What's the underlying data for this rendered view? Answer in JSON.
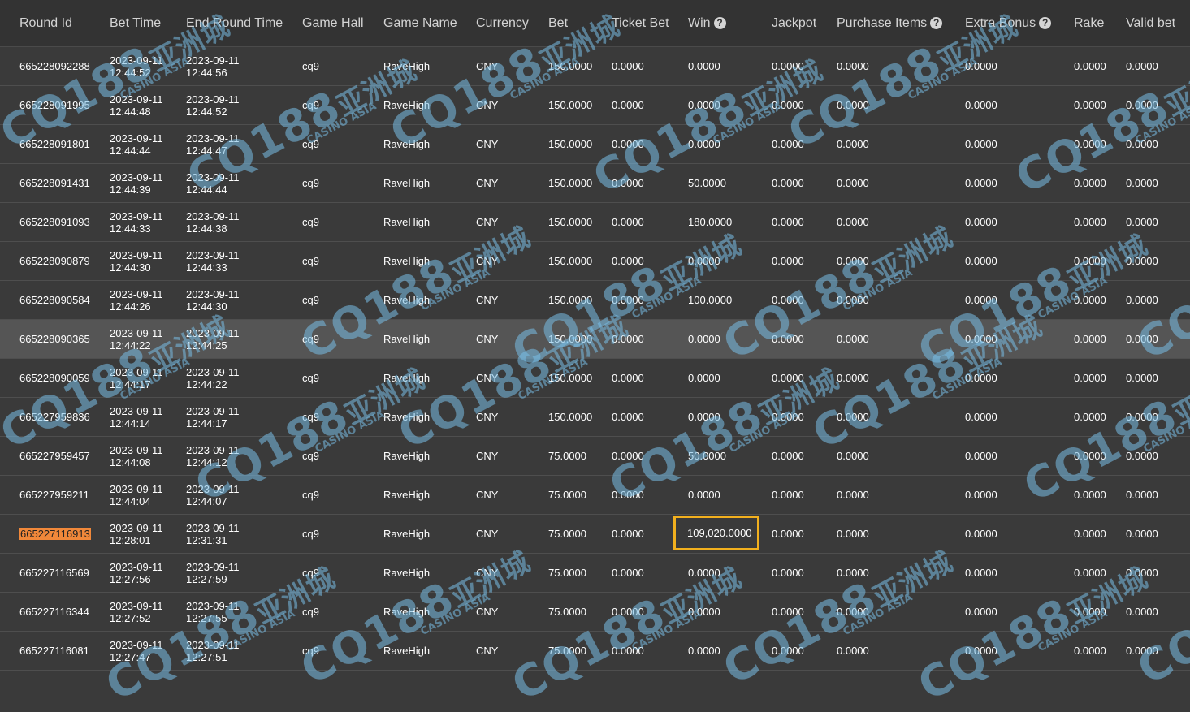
{
  "headers": [
    {
      "label": "Round Id",
      "help": false
    },
    {
      "label": "Bet Time",
      "help": false
    },
    {
      "label": "End Round Time",
      "help": false
    },
    {
      "label": "Game Hall",
      "help": false
    },
    {
      "label": "Game Name",
      "help": false
    },
    {
      "label": "Currency",
      "help": false
    },
    {
      "label": "Bet",
      "help": false
    },
    {
      "label": "Ticket Bet",
      "help": false
    },
    {
      "label": "Win",
      "help": true
    },
    {
      "label": "Jackpot",
      "help": false
    },
    {
      "label": "Purchase Items",
      "help": true
    },
    {
      "label": "Extra Bonus",
      "help": true
    },
    {
      "label": "Rake",
      "help": false
    },
    {
      "label": "Valid bet",
      "help": false
    }
  ],
  "help_glyph": "?",
  "rows": [
    {
      "round_id": "665228092288",
      "bet_date": "2023-09-11",
      "bet_time": "12:44:52",
      "end_date": "2023-09-11",
      "end_time": "12:44:56",
      "hall": "cq9",
      "game": "RaveHigh",
      "currency": "CNY",
      "bet": "150.0000",
      "ticket_bet": "0.0000",
      "win": "0.0000",
      "jackpot": "0.0000",
      "purchase": "0.0000",
      "extra": "0.0000",
      "rake": "0.0000",
      "valid": "0.0000"
    },
    {
      "round_id": "665228091995",
      "bet_date": "2023-09-11",
      "bet_time": "12:44:48",
      "end_date": "2023-09-11",
      "end_time": "12:44:52",
      "hall": "cq9",
      "game": "RaveHigh",
      "currency": "CNY",
      "bet": "150.0000",
      "ticket_bet": "0.0000",
      "win": "0.0000",
      "jackpot": "0.0000",
      "purchase": "0.0000",
      "extra": "0.0000",
      "rake": "0.0000",
      "valid": "0.0000"
    },
    {
      "round_id": "665228091801",
      "bet_date": "2023-09-11",
      "bet_time": "12:44:44",
      "end_date": "2023-09-11",
      "end_time": "12:44:47",
      "hall": "cq9",
      "game": "RaveHigh",
      "currency": "CNY",
      "bet": "150.0000",
      "ticket_bet": "0.0000",
      "win": "0.0000",
      "jackpot": "0.0000",
      "purchase": "0.0000",
      "extra": "0.0000",
      "rake": "0.0000",
      "valid": "0.0000"
    },
    {
      "round_id": "665228091431",
      "bet_date": "2023-09-11",
      "bet_time": "12:44:39",
      "end_date": "2023-09-11",
      "end_time": "12:44:44",
      "hall": "cq9",
      "game": "RaveHigh",
      "currency": "CNY",
      "bet": "150.0000",
      "ticket_bet": "0.0000",
      "win": "50.0000",
      "jackpot": "0.0000",
      "purchase": "0.0000",
      "extra": "0.0000",
      "rake": "0.0000",
      "valid": "0.0000"
    },
    {
      "round_id": "665228091093",
      "bet_date": "2023-09-11",
      "bet_time": "12:44:33",
      "end_date": "2023-09-11",
      "end_time": "12:44:38",
      "hall": "cq9",
      "game": "RaveHigh",
      "currency": "CNY",
      "bet": "150.0000",
      "ticket_bet": "0.0000",
      "win": "180.0000",
      "jackpot": "0.0000",
      "purchase": "0.0000",
      "extra": "0.0000",
      "rake": "0.0000",
      "valid": "0.0000"
    },
    {
      "round_id": "665228090879",
      "bet_date": "2023-09-11",
      "bet_time": "12:44:30",
      "end_date": "2023-09-11",
      "end_time": "12:44:33",
      "hall": "cq9",
      "game": "RaveHigh",
      "currency": "CNY",
      "bet": "150.0000",
      "ticket_bet": "0.0000",
      "win": "0.0000",
      "jackpot": "0.0000",
      "purchase": "0.0000",
      "extra": "0.0000",
      "rake": "0.0000",
      "valid": "0.0000"
    },
    {
      "round_id": "665228090584",
      "bet_date": "2023-09-11",
      "bet_time": "12:44:26",
      "end_date": "2023-09-11",
      "end_time": "12:44:30",
      "hall": "cq9",
      "game": "RaveHigh",
      "currency": "CNY",
      "bet": "150.0000",
      "ticket_bet": "0.0000",
      "win": "100.0000",
      "jackpot": "0.0000",
      "purchase": "0.0000",
      "extra": "0.0000",
      "rake": "0.0000",
      "valid": "0.0000"
    },
    {
      "round_id": "665228090365",
      "bet_date": "2023-09-11",
      "bet_time": "12:44:22",
      "end_date": "2023-09-11",
      "end_time": "12:44:25",
      "hall": "cq9",
      "game": "RaveHigh",
      "currency": "CNY",
      "bet": "150.0000",
      "ticket_bet": "0.0000",
      "win": "0.0000",
      "jackpot": "0.0000",
      "purchase": "0.0000",
      "extra": "0.0000",
      "rake": "0.0000",
      "valid": "0.0000",
      "hovered": true
    },
    {
      "round_id": "665228090059",
      "bet_date": "2023-09-11",
      "bet_time": "12:44:17",
      "end_date": "2023-09-11",
      "end_time": "12:44:22",
      "hall": "cq9",
      "game": "RaveHigh",
      "currency": "CNY",
      "bet": "150.0000",
      "ticket_bet": "0.0000",
      "win": "0.0000",
      "jackpot": "0.0000",
      "purchase": "0.0000",
      "extra": "0.0000",
      "rake": "0.0000",
      "valid": "0.0000"
    },
    {
      "round_id": "665227959836",
      "bet_date": "2023-09-11",
      "bet_time": "12:44:14",
      "end_date": "2023-09-11",
      "end_time": "12:44:17",
      "hall": "cq9",
      "game": "RaveHigh",
      "currency": "CNY",
      "bet": "150.0000",
      "ticket_bet": "0.0000",
      "win": "0.0000",
      "jackpot": "0.0000",
      "purchase": "0.0000",
      "extra": "0.0000",
      "rake": "0.0000",
      "valid": "0.0000"
    },
    {
      "round_id": "665227959457",
      "bet_date": "2023-09-11",
      "bet_time": "12:44:08",
      "end_date": "2023-09-11",
      "end_time": "12:44:12",
      "hall": "cq9",
      "game": "RaveHigh",
      "currency": "CNY",
      "bet": "75.0000",
      "ticket_bet": "0.0000",
      "win": "50.0000",
      "jackpot": "0.0000",
      "purchase": "0.0000",
      "extra": "0.0000",
      "rake": "0.0000",
      "valid": "0.0000"
    },
    {
      "round_id": "665227959211",
      "bet_date": "2023-09-11",
      "bet_time": "12:44:04",
      "end_date": "2023-09-11",
      "end_time": "12:44:07",
      "hall": "cq9",
      "game": "RaveHigh",
      "currency": "CNY",
      "bet": "75.0000",
      "ticket_bet": "0.0000",
      "win": "0.0000",
      "jackpot": "0.0000",
      "purchase": "0.0000",
      "extra": "0.0000",
      "rake": "0.0000",
      "valid": "0.0000"
    },
    {
      "round_id": "665227116913",
      "bet_date": "2023-09-11",
      "bet_time": "12:28:01",
      "end_date": "2023-09-11",
      "end_time": "12:31:31",
      "hall": "cq9",
      "game": "RaveHigh",
      "currency": "CNY",
      "bet": "75.0000",
      "ticket_bet": "0.0000",
      "win": "109,020.0000",
      "jackpot": "0.0000",
      "purchase": "0.0000",
      "extra": "0.0000",
      "rake": "0.0000",
      "valid": "0.0000",
      "round_highlight": true,
      "win_boxed": true
    },
    {
      "round_id": "665227116569",
      "bet_date": "2023-09-11",
      "bet_time": "12:27:56",
      "end_date": "2023-09-11",
      "end_time": "12:27:59",
      "hall": "cq9",
      "game": "RaveHigh",
      "currency": "CNY",
      "bet": "75.0000",
      "ticket_bet": "0.0000",
      "win": "0.0000",
      "jackpot": "0.0000",
      "purchase": "0.0000",
      "extra": "0.0000",
      "rake": "0.0000",
      "valid": "0.0000"
    },
    {
      "round_id": "665227116344",
      "bet_date": "2023-09-11",
      "bet_time": "12:27:52",
      "end_date": "2023-09-11",
      "end_time": "12:27:55",
      "hall": "cq9",
      "game": "RaveHigh",
      "currency": "CNY",
      "bet": "75.0000",
      "ticket_bet": "0.0000",
      "win": "0.0000",
      "jackpot": "0.0000",
      "purchase": "0.0000",
      "extra": "0.0000",
      "rake": "0.0000",
      "valid": "0.0000"
    },
    {
      "round_id": "665227116081",
      "bet_date": "2023-09-11",
      "bet_time": "12:27:47",
      "end_date": "2023-09-11",
      "end_time": "12:27:51",
      "hall": "cq9",
      "game": "RaveHigh",
      "currency": "CNY",
      "bet": "75.0000",
      "ticket_bet": "0.0000",
      "win": "0.0000",
      "jackpot": "0.0000",
      "purchase": "0.0000",
      "extra": "0.0000",
      "rake": "0.0000",
      "valid": "0.0000"
    }
  ],
  "watermark": {
    "logo": "CQ188",
    "cn": "亚洲城",
    "en": "CASINO ASIA"
  },
  "colors": {
    "background": "#3a3a3a",
    "header": "#333333",
    "hover_row": "#555555",
    "round_highlight": "#f0883a",
    "win_box": "#f2b01e",
    "watermark": "#78bee6"
  }
}
